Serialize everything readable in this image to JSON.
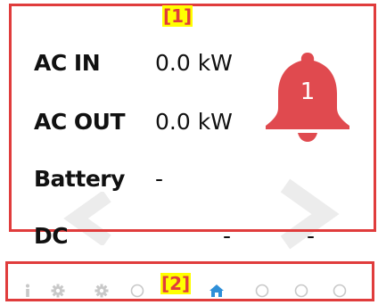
{
  "annotations": {
    "panel_tag": "[1]",
    "dots_tag": "[2]",
    "box_color": "#e03c3c",
    "tag_bg": "#ffff00"
  },
  "rows": {
    "ac_in": {
      "label": "AC IN",
      "value": "0.0 kW"
    },
    "ac_out": {
      "label": "AC OUT",
      "value": "0.0 kW"
    },
    "battery": {
      "label": "Battery",
      "value": "-"
    },
    "dc": {
      "label": "DC",
      "value_1": "-",
      "value_2": "-"
    }
  },
  "alarm": {
    "icon": "bell-icon",
    "count": "1",
    "color": "#e04a4f"
  },
  "navigation": {
    "prev_icon": "chevron-left-icon",
    "next_icon": "chevron-right-icon"
  },
  "page_dots": {
    "items": [
      {
        "icon": "info-icon"
      },
      {
        "icon": "gear-icon"
      },
      {
        "icon": "gear-icon"
      },
      {
        "icon": "circle-icon"
      },
      {
        "icon": "circle-icon"
      },
      {
        "icon": "home-icon",
        "active": true
      },
      {
        "icon": "circle-icon"
      },
      {
        "icon": "circle-icon"
      },
      {
        "icon": "circle-icon"
      }
    ],
    "active_color": "#2f8fd8",
    "inactive_color": "#c8c8c8"
  }
}
